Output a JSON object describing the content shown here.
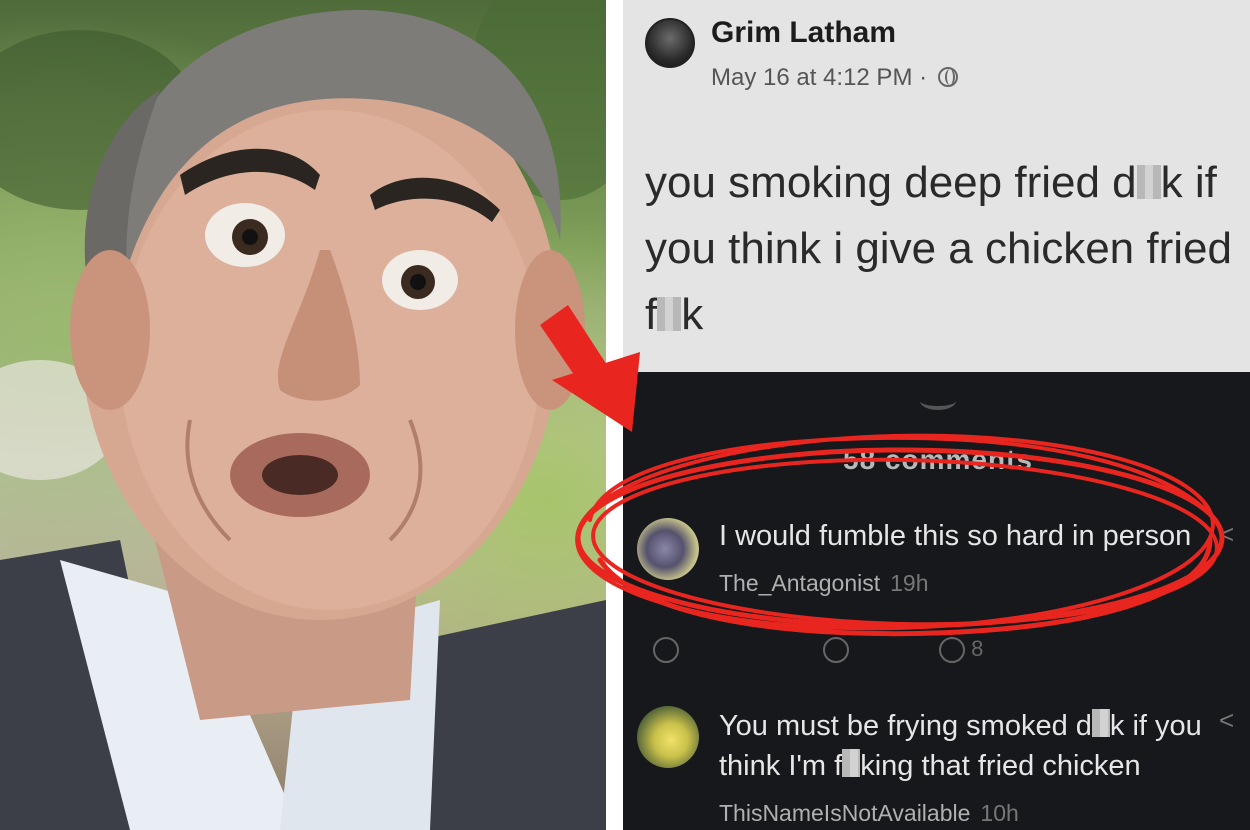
{
  "post": {
    "author": "Grim Latham",
    "timestamp": "May 16 at 4:12 PM ·",
    "text_line1_a": "you smoking deep fried d",
    "text_line1_b": "k if",
    "text_line2": "you think i give a chicken fried",
    "text_line3_a": "f",
    "text_line3_b": "k"
  },
  "comments_header": "58 comments",
  "comments": [
    {
      "text": "I would fumble this so hard in person",
      "username": "The_Antagonist",
      "time": "19h"
    },
    {
      "text_a": "You must be frying smoked d",
      "text_b": "k if you",
      "text_line2_a": "think I'm f",
      "text_line2_b": "king that fried chicken",
      "username": "ThisNameIsNotAvailable",
      "time": "10h"
    }
  ],
  "actions": {
    "share_count": "8"
  },
  "colors": {
    "annotation_red": "#e8261f",
    "post_bg": "#e4e4e4",
    "comments_bg": "#16181c"
  }
}
